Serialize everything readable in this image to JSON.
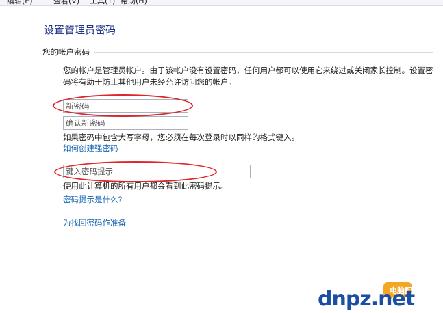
{
  "menubar": {
    "items": [
      "编辑(E)",
      "查看(V)",
      "工具(T)",
      "帮助(H)"
    ]
  },
  "page": {
    "title": "设置管理员密码",
    "section_label": "您的帐户密码",
    "description": "您的帐户是管理员帐户。由于该帐户没有设置密码，任何用户都可以使用它来绕过或关闭家长控制。设置密码将有助于防止其他用户未经允许访问您的帐户。"
  },
  "form": {
    "new_password_placeholder": "新密码",
    "confirm_password_placeholder": "确认新密码",
    "case_note": "如果密码中包含大写字母，您必须在每次登录时以同样的格式键入。",
    "strong_password_link": "如何创建强密码",
    "hint_placeholder": "键入密码提示",
    "hint_note": "使用此计算机的所有用户都会看到此密码提示。",
    "hint_link": "密码提示是什么?",
    "recovery_link": "为找回密码作准备"
  },
  "watermark": {
    "brand_text": "dnpz.net",
    "site_name": "电脑配置网"
  },
  "colors": {
    "title_blue": "#1e3287",
    "link_blue": "#1564b0",
    "annotation_red": "#e02428",
    "logo_blue": "#1a4fa3",
    "logo_orange": "#f5a623"
  }
}
